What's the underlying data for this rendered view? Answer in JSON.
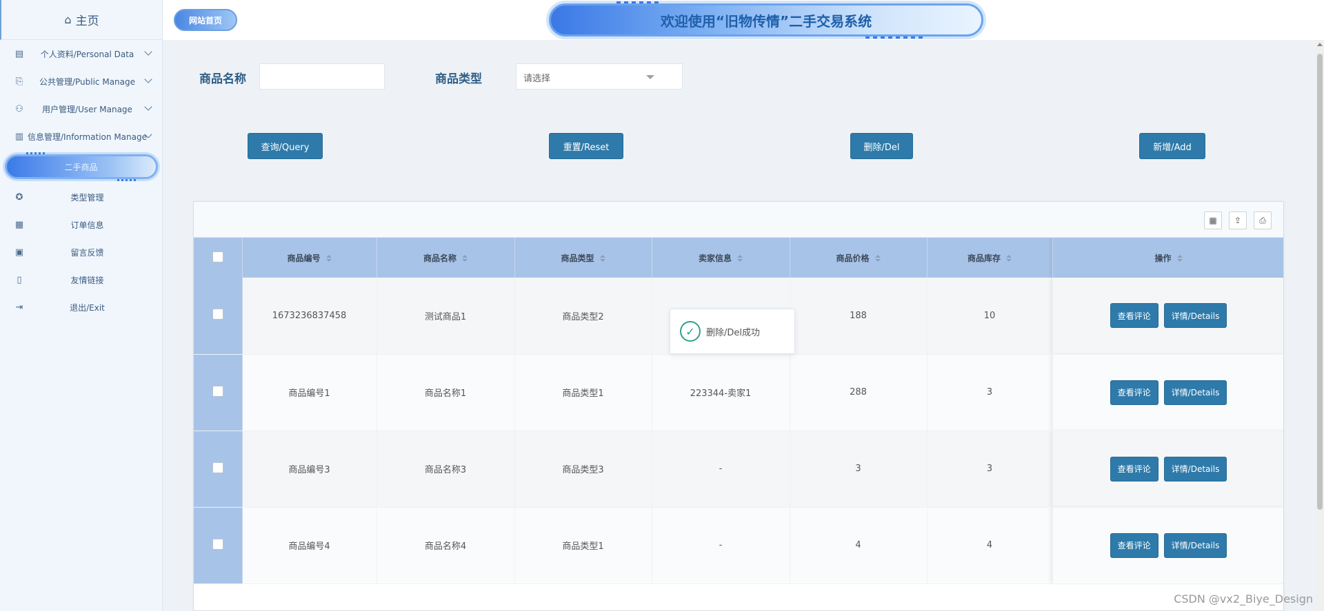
{
  "sidebar": {
    "home_label": "主页",
    "items": [
      {
        "label": "个人资料/Personal Data",
        "icon": "profile-icon",
        "has_chevron": true
      },
      {
        "label": "公共管理/Public Manage",
        "icon": "clipboard-icon",
        "has_chevron": true
      },
      {
        "label": "用户管理/User Manage",
        "icon": "user-manage-icon",
        "has_chevron": true
      },
      {
        "label": "信息管理/Information Manage",
        "icon": "chart-icon",
        "has_chevron": true
      }
    ],
    "active_item": "二手商品",
    "sub_items": [
      {
        "label": "类型管理",
        "icon": "badge-icon"
      },
      {
        "label": "订单信息",
        "icon": "calendar-icon"
      },
      {
        "label": "留言反馈",
        "icon": "calendar-check-icon"
      },
      {
        "label": "友情链接",
        "icon": "book-icon"
      },
      {
        "label": "退出/Exit",
        "icon": "logout-icon"
      }
    ]
  },
  "header": {
    "logo_label": "网站首页",
    "banner_title": "欢迎使用“旧物传情”二手交易系统"
  },
  "search": {
    "name_label": "商品名称",
    "name_value": "",
    "type_label": "商品类型",
    "type_placeholder": "请选择"
  },
  "actions": {
    "query": "查询/Query",
    "reset": "重置/Reset",
    "delete": "删除/Del",
    "add": "新增/Add"
  },
  "table": {
    "headers": [
      "商品编号",
      "商品名称",
      "商品类型",
      "卖家信息",
      "商品价格",
      "商品库存",
      "操作"
    ],
    "rows": [
      {
        "id": "1673236837458",
        "name": "测试商品1",
        "type": "商品类型2",
        "seller": "",
        "price": "188",
        "stock": "10"
      },
      {
        "id": "商品编号1",
        "name": "商品名称1",
        "type": "商品类型1",
        "seller": "223344-卖家1",
        "price": "288",
        "stock": "3"
      },
      {
        "id": "商品编号3",
        "name": "商品名称3",
        "type": "商品类型3",
        "seller": "-",
        "price": "3",
        "stock": "3"
      },
      {
        "id": "商品编号4",
        "name": "商品名称4",
        "type": "商品类型1",
        "seller": "-",
        "price": "4",
        "stock": "4"
      }
    ],
    "row_actions": {
      "comments": "查看评论",
      "details": "详情/Details"
    }
  },
  "toast": {
    "message": "删除/Del成功"
  },
  "watermark": "CSDN @vx2_Biye_Design",
  "colors": {
    "primary_button": "#2e7aaa",
    "header_row": "#a8c3e8",
    "success": "#2ea18a"
  }
}
